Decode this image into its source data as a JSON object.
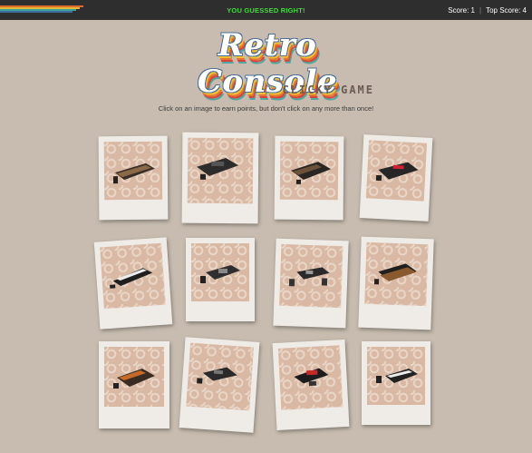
{
  "header": {
    "status": "YOU GUESSED RIGHT!",
    "score_label": "Score: 1",
    "top_score_label": "Top Score: 4",
    "stripe_colors": [
      "#e06a2a",
      "#e0b93a",
      "#3fa29a",
      "#3b6fa0"
    ]
  },
  "logo": {
    "title": "Retro Console",
    "subtitle": "CLICKY GAME"
  },
  "instructions": "Click on an image to earn points, but don't click on any more than once!",
  "cards": [
    {
      "alt": "retro console 1"
    },
    {
      "alt": "retro console 2"
    },
    {
      "alt": "retro console 3"
    },
    {
      "alt": "retro console 4"
    },
    {
      "alt": "retro console 5"
    },
    {
      "alt": "retro console 6"
    },
    {
      "alt": "retro console 7"
    },
    {
      "alt": "retro console 8"
    },
    {
      "alt": "retro console 9"
    },
    {
      "alt": "retro console 10"
    },
    {
      "alt": "retro console 11"
    },
    {
      "alt": "retro console 12"
    }
  ]
}
